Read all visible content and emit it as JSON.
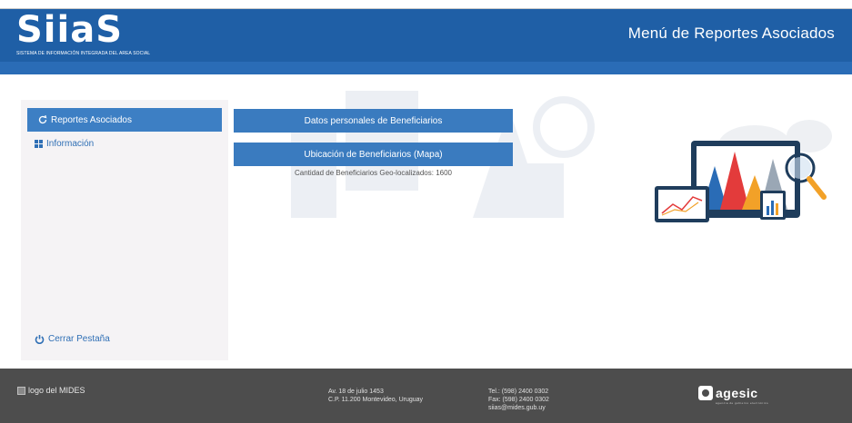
{
  "header": {
    "brand": "SiiaS",
    "brand_subtitle": "SISTEMA DE INFORMACIÓN INTEGRADA DEL AREA SOCIAL",
    "title": "Menú de Reportes Asociados"
  },
  "sidebar": {
    "items": [
      {
        "label": "Reportes Asociados",
        "icon": "refresh-icon",
        "active": true
      },
      {
        "label": "Información",
        "icon": "grid-icon",
        "active": false
      }
    ],
    "close_label": "Cerrar Pestaña",
    "close_icon": "power-icon"
  },
  "main": {
    "buttons": [
      {
        "label": "Datos personales de Beneficiarios"
      },
      {
        "label": "Ubicación de Beneficiarios (Mapa)"
      }
    ],
    "geo_count_text": "Cantidad de Beneficiarios Geo-localizados: 1600"
  },
  "footer": {
    "logo_alt": "logo del MIDES",
    "address_line1": "Av. 18 de julio 1453",
    "address_line2": "C.P. 11.200 Montevideo, Uruguay",
    "tel": "Tel.: (598) 2400 0302",
    "fax": "Fax: (598) 2400 0302",
    "email": "siias@mides.gub.uy",
    "partner_logo": "agesic",
    "partner_sub": "agencia de gobierno electrónico"
  },
  "colors": {
    "header": "#1f5fa6",
    "button": "#3a7bbf",
    "sidebar_bg": "#f5f3f5",
    "footer": "#4d4d4d"
  }
}
